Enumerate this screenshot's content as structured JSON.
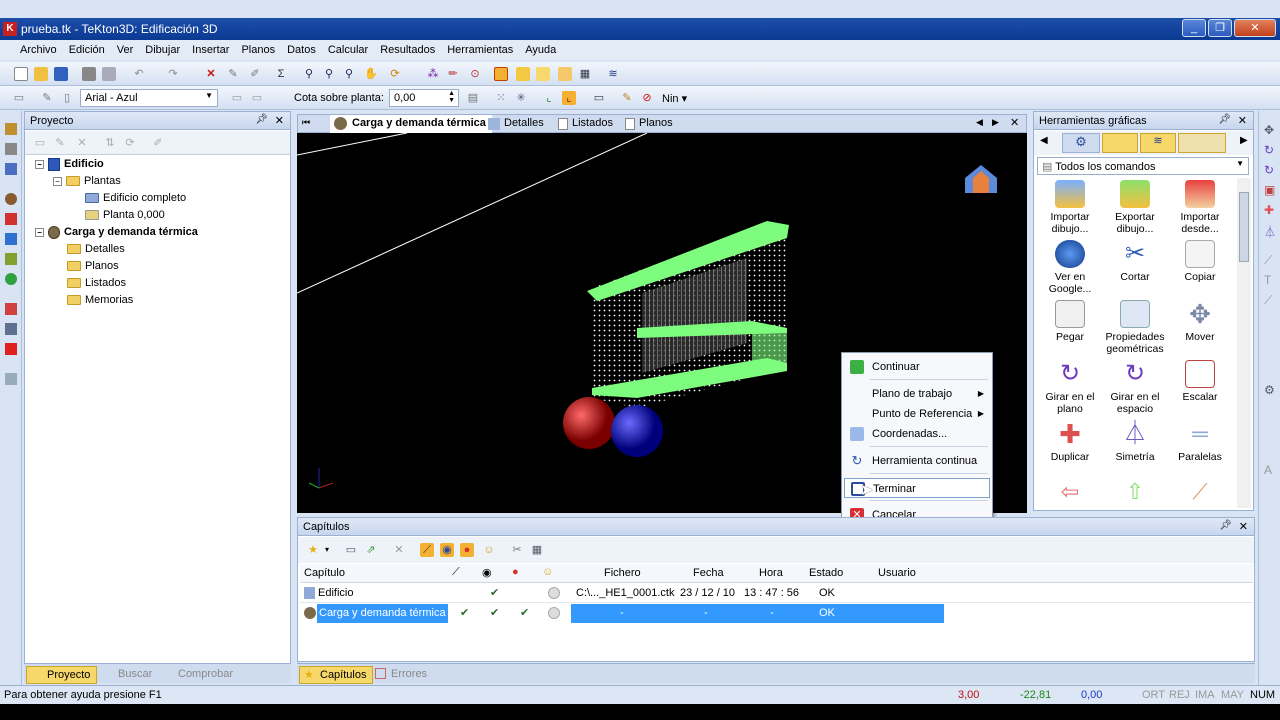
{
  "window": {
    "title": "prueba.tk - TeKton3D: Edificación 3D",
    "icon_text": "K"
  },
  "menu": [
    "Archivo",
    "Edición",
    "Ver",
    "Dibujar",
    "Insertar",
    "Planos",
    "Datos",
    "Calcular",
    "Resultados",
    "Herramientas",
    "Ayuda"
  ],
  "toolbar": {
    "font_combo": "Arial - Azul",
    "cota_label": "Cota sobre planta:",
    "cota_value": "0,00",
    "nin_label": "Nin"
  },
  "project_panel": {
    "title": "Proyecto",
    "tree": {
      "edificio": "Edificio",
      "plantas": "Plantas",
      "edificio_completo": "Edificio completo",
      "planta": "Planta 0,000",
      "carga": "Carga y demanda térmica",
      "detalles": "Detalles",
      "planos": "Planos",
      "listados": "Listados",
      "memorias": "Memorias"
    },
    "bottom_tabs": {
      "proyecto": "Proyecto",
      "buscar": "Buscar",
      "comprobar": "Comprobar"
    }
  },
  "view_tabs": {
    "active": "Carga y demanda térmica",
    "detalles": "Detalles",
    "listados": "Listados",
    "planos": "Planos"
  },
  "context_menu": {
    "continuar": "Continuar",
    "plano_trabajo": "Plano de trabajo",
    "punto_referencia": "Punto de Referencia",
    "coordenadas": "Coordenadas...",
    "herramienta_continua": "Herramienta continua",
    "terminar": "Terminar",
    "cancelar": "Cancelar"
  },
  "tools_panel": {
    "title": "Herramientas gráficas",
    "filter": "Todos los comandos",
    "tools": {
      "importar_dibujo": "Importar dibujo...",
      "exportar_dibujo": "Exportar dibujo...",
      "importar_desde": "Importar desde...",
      "ver_google": "Ver en Google...",
      "cortar": "Cortar",
      "copiar": "Copiar",
      "pegar": "Pegar",
      "propiedades": "Propiedades geométricas",
      "mover": "Mover",
      "girar_plano": "Girar en el plano",
      "girar_espacio": "Girar en el espacio",
      "escalar": "Escalar",
      "duplicar": "Duplicar",
      "simetria": "Simetría",
      "paralelas": "Paralelas"
    }
  },
  "capitulos": {
    "title": "Capítulos",
    "columns": {
      "capitulo": "Capítulo",
      "fichero": "Fichero",
      "fecha": "Fecha",
      "hora": "Hora",
      "estado": "Estado",
      "usuario": "Usuario"
    },
    "rows": [
      {
        "name": "Edificio",
        "c1": "",
        "c2": "✔",
        "c3": "",
        "fichero": "C:\\..._HE1_0001.ctk",
        "fecha": "23 / 12 / 10",
        "hora": "13 : 47 : 56",
        "estado": "OK",
        "usuario": ""
      },
      {
        "name": "Carga y demanda térmica",
        "c1": "✔",
        "c2": "✔",
        "c3": "✔",
        "fichero": "-",
        "fecha": "-",
        "hora": "-",
        "estado": "OK",
        "usuario": ""
      }
    ],
    "bottom_tabs": {
      "capitulos": "Capítulos",
      "errores": "Errores"
    }
  },
  "status": {
    "help": "Para obtener ayuda presione F1",
    "x": "3,00",
    "y": "-22,81",
    "z": "0,00",
    "ort": "ORT",
    "rej": "REJ",
    "ima": "IMA",
    "may": "MAY",
    "num": "NUM"
  },
  "colors": {
    "accent": "#1c4da8",
    "selection": "#3399ff",
    "model_green": "#7dfc7d"
  }
}
